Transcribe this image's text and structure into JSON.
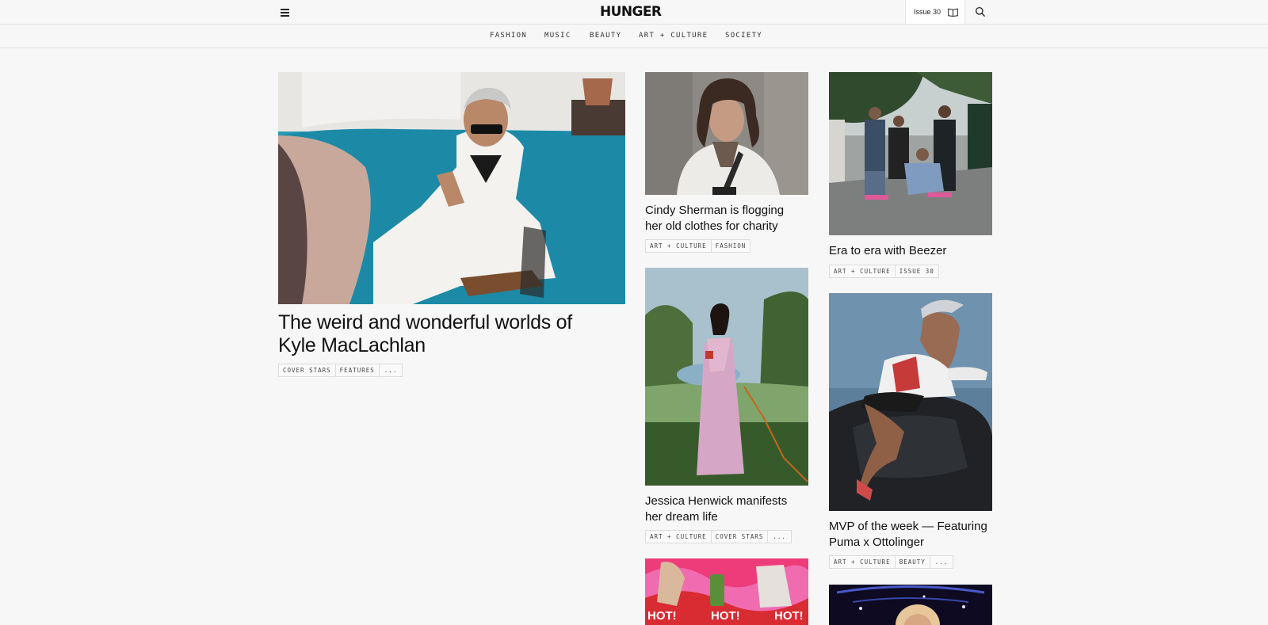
{
  "header": {
    "logo": "HUNGER",
    "issue_label": "Issue 30"
  },
  "nav": {
    "items": [
      "FASHION",
      "MUSIC",
      "BEAUTY",
      "ART + CULTURE",
      "SOCIETY"
    ]
  },
  "articles": [
    {
      "title_line1": "The weird and wonderful worlds of",
      "title_line2": "Kyle MacLachlan",
      "tags": [
        "COVER STARS",
        "FEATURES",
        "..."
      ]
    },
    {
      "title_line1": "Cindy Sherman is flogging",
      "title_line2": "her old clothes for charity",
      "tags": [
        "ART + CULTURE",
        "FASHION"
      ]
    },
    {
      "title_line1": "Era to era with Beezer",
      "title_line2": "",
      "tags": [
        "ART + CULTURE",
        "ISSUE 30"
      ]
    },
    {
      "title_line1": "Jessica Henwick manifests",
      "title_line2": "her dream life",
      "tags": [
        "ART + CULTURE",
        "COVER STARS",
        "..."
      ]
    },
    {
      "title_line1": "MVP of the week — Featuring",
      "title_line2": "Puma x Ottolinger",
      "tags": [
        "ART + CULTURE",
        "BEAUTY",
        "..."
      ]
    },
    {
      "overlay_text": "HOT!"
    }
  ]
}
